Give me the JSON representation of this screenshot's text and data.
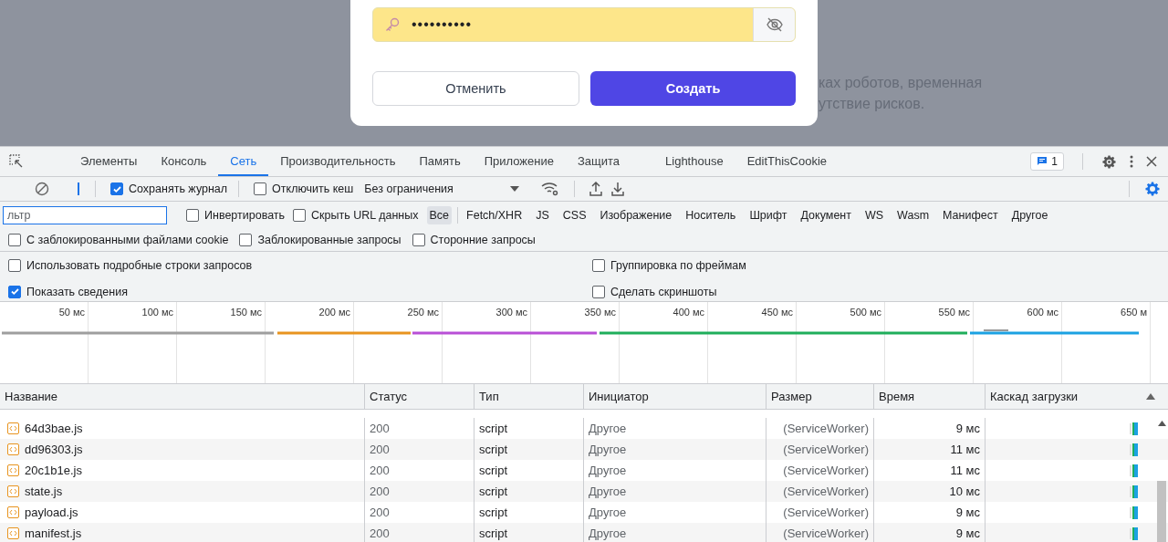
{
  "page": {
    "background_text": [
      "ках роботов, временная",
      "утствие рисков."
    ],
    "dialog": {
      "password": {
        "value": "••••••••••"
      },
      "buttons": [
        {
          "label": "Отменить",
          "kind": "secondary"
        },
        {
          "label": "Создать",
          "kind": "primary"
        }
      ]
    }
  },
  "devtools": {
    "tabs": [
      {
        "label": "Элементы",
        "selected": false
      },
      {
        "label": "Консоль",
        "selected": false
      },
      {
        "label": "Сеть",
        "selected": true
      },
      {
        "label": "Производительность",
        "selected": false
      },
      {
        "label": "Память",
        "selected": false
      },
      {
        "label": "Приложение",
        "selected": false
      },
      {
        "label": "Защита",
        "selected": false
      },
      {
        "label": "Lighthouse",
        "selected": false
      },
      {
        "label": "EditThisCookie",
        "selected": false
      }
    ],
    "issues_badge": "1",
    "toolbar": {
      "checkboxes": [
        {
          "label": "Сохранять журнал",
          "checked": true
        },
        {
          "label": "Отключить кеш",
          "checked": false
        }
      ],
      "throttling": "Без ограничения"
    },
    "filter": {
      "placeholder": "льтр"
    },
    "filter_options": [
      {
        "label": "Инвертировать",
        "checked": false
      },
      {
        "label": "Скрыть URL данных",
        "checked": false
      }
    ],
    "type_filters": [
      {
        "label": "Все",
        "selected": true
      },
      {
        "label": "Fetch/XHR",
        "selected": false
      },
      {
        "label": "JS",
        "selected": false
      },
      {
        "label": "CSS",
        "selected": false
      },
      {
        "label": "Изображение",
        "selected": false
      },
      {
        "label": "Носитель",
        "selected": false
      },
      {
        "label": "Шрифт",
        "selected": false
      },
      {
        "label": "Документ",
        "selected": false
      },
      {
        "label": "WS",
        "selected": false
      },
      {
        "label": "Wasm",
        "selected": false
      },
      {
        "label": "Манифест",
        "selected": false
      },
      {
        "label": "Другое",
        "selected": false
      }
    ],
    "request_filters": [
      {
        "label": "С заблокированными файлами cookie",
        "checked": false
      },
      {
        "label": "Заблокированные запросы",
        "checked": false
      },
      {
        "label": "Сторонние запросы",
        "checked": false
      }
    ],
    "settings": {
      "left": [
        {
          "label": "Использовать подробные строки запросов",
          "checked": false
        },
        {
          "label": "Показать сведения",
          "checked": true
        }
      ],
      "right": [
        {
          "label": "Группировка по фреймам",
          "checked": false
        },
        {
          "label": "Сделать скриншоты",
          "checked": false
        }
      ]
    },
    "overview": {
      "ticks": [
        "50 мс",
        "100 мс",
        "150 мс",
        "200 мс",
        "250 мс",
        "300 мс",
        "350 мс",
        "400 мс",
        "450 мс",
        "500 мс",
        "550 мс",
        "600 мс",
        "650 м"
      ]
    },
    "table": {
      "columns": [
        "Название",
        "Статус",
        "Тип",
        "Инициатор",
        "Размер",
        "Время",
        "Каскад загрузки"
      ],
      "rows": [
        {
          "name": "64d3bae.js",
          "status": "200",
          "type": "script",
          "initiator": "Другое",
          "size": "(ServiceWorker)",
          "time": "9 мс"
        },
        {
          "name": "dd96303.js",
          "status": "200",
          "type": "script",
          "initiator": "Другое",
          "size": "(ServiceWorker)",
          "time": "11 мс"
        },
        {
          "name": "20c1b1e.js",
          "status": "200",
          "type": "script",
          "initiator": "Другое",
          "size": "(ServiceWorker)",
          "time": "11 мс"
        },
        {
          "name": "state.js",
          "status": "200",
          "type": "script",
          "initiator": "Другое",
          "size": "(ServiceWorker)",
          "time": "10 мс"
        },
        {
          "name": "payload.js",
          "status": "200",
          "type": "script",
          "initiator": "Другое",
          "size": "(ServiceWorker)",
          "time": "9 мс"
        },
        {
          "name": "manifest.js",
          "status": "200",
          "type": "script",
          "initiator": "Другое",
          "size": "(ServiceWorker)",
          "time": "9 мс"
        }
      ]
    }
  }
}
